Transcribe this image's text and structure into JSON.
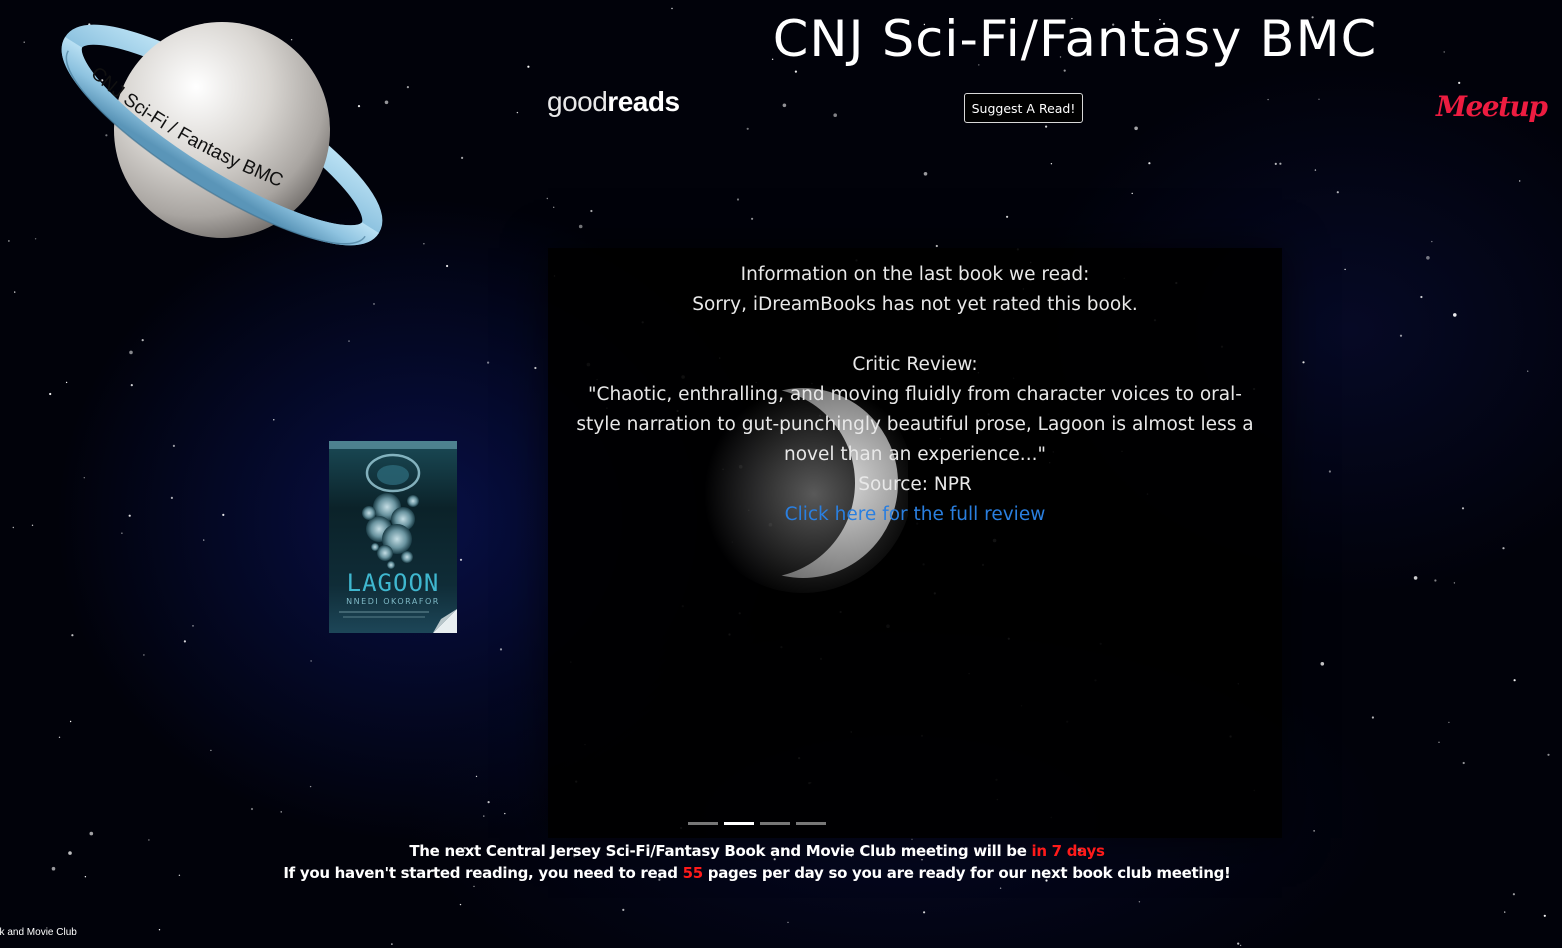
{
  "header": {
    "title": "CNJ Sci-Fi/Fantasy BMC",
    "logo_ring_text": "CNJ Sci-Fi / Fantasy BMC",
    "goodreads": {
      "light": "good",
      "bold": "reads"
    },
    "suggest_button": "Suggest A Read!",
    "meetup": "Meetup"
  },
  "slide": {
    "intro": "Information on the last book we read:",
    "rating_note": "Sorry, iDreamBooks has not yet rated this book.",
    "critic_label": "Critic Review:",
    "quote": "\"Chaotic, enthralling, and moving fluidly from character voices to oral-style narration to gut-punchingly beautiful prose, Lagoon is almost less a novel than an experience...\"",
    "source": "Source: NPR",
    "link_text": "Click here for the full review"
  },
  "book": {
    "title": "LAGOON",
    "author": "NNEDI OKORAFOR"
  },
  "carousel": {
    "indicator_count": 4,
    "active_index": 1
  },
  "countdown": {
    "line1_prefix": "The next Central Jersey Sci-Fi/Fantasy Book and Movie Club meeting will be ",
    "line1_highlight": "in 7 days",
    "line2_prefix": "If you haven't started reading, you need to read ",
    "line2_highlight": "55",
    "line2_suffix": " pages per day so you are ready for our next book club meeting!"
  },
  "footer": {
    "text": "ok and Movie Club"
  },
  "colors": {
    "accent_red": "#ff1a1a",
    "link_blue": "#2a7fe0",
    "meetup_red": "#ed1c40",
    "ring_blue": "#8ec3e0"
  }
}
